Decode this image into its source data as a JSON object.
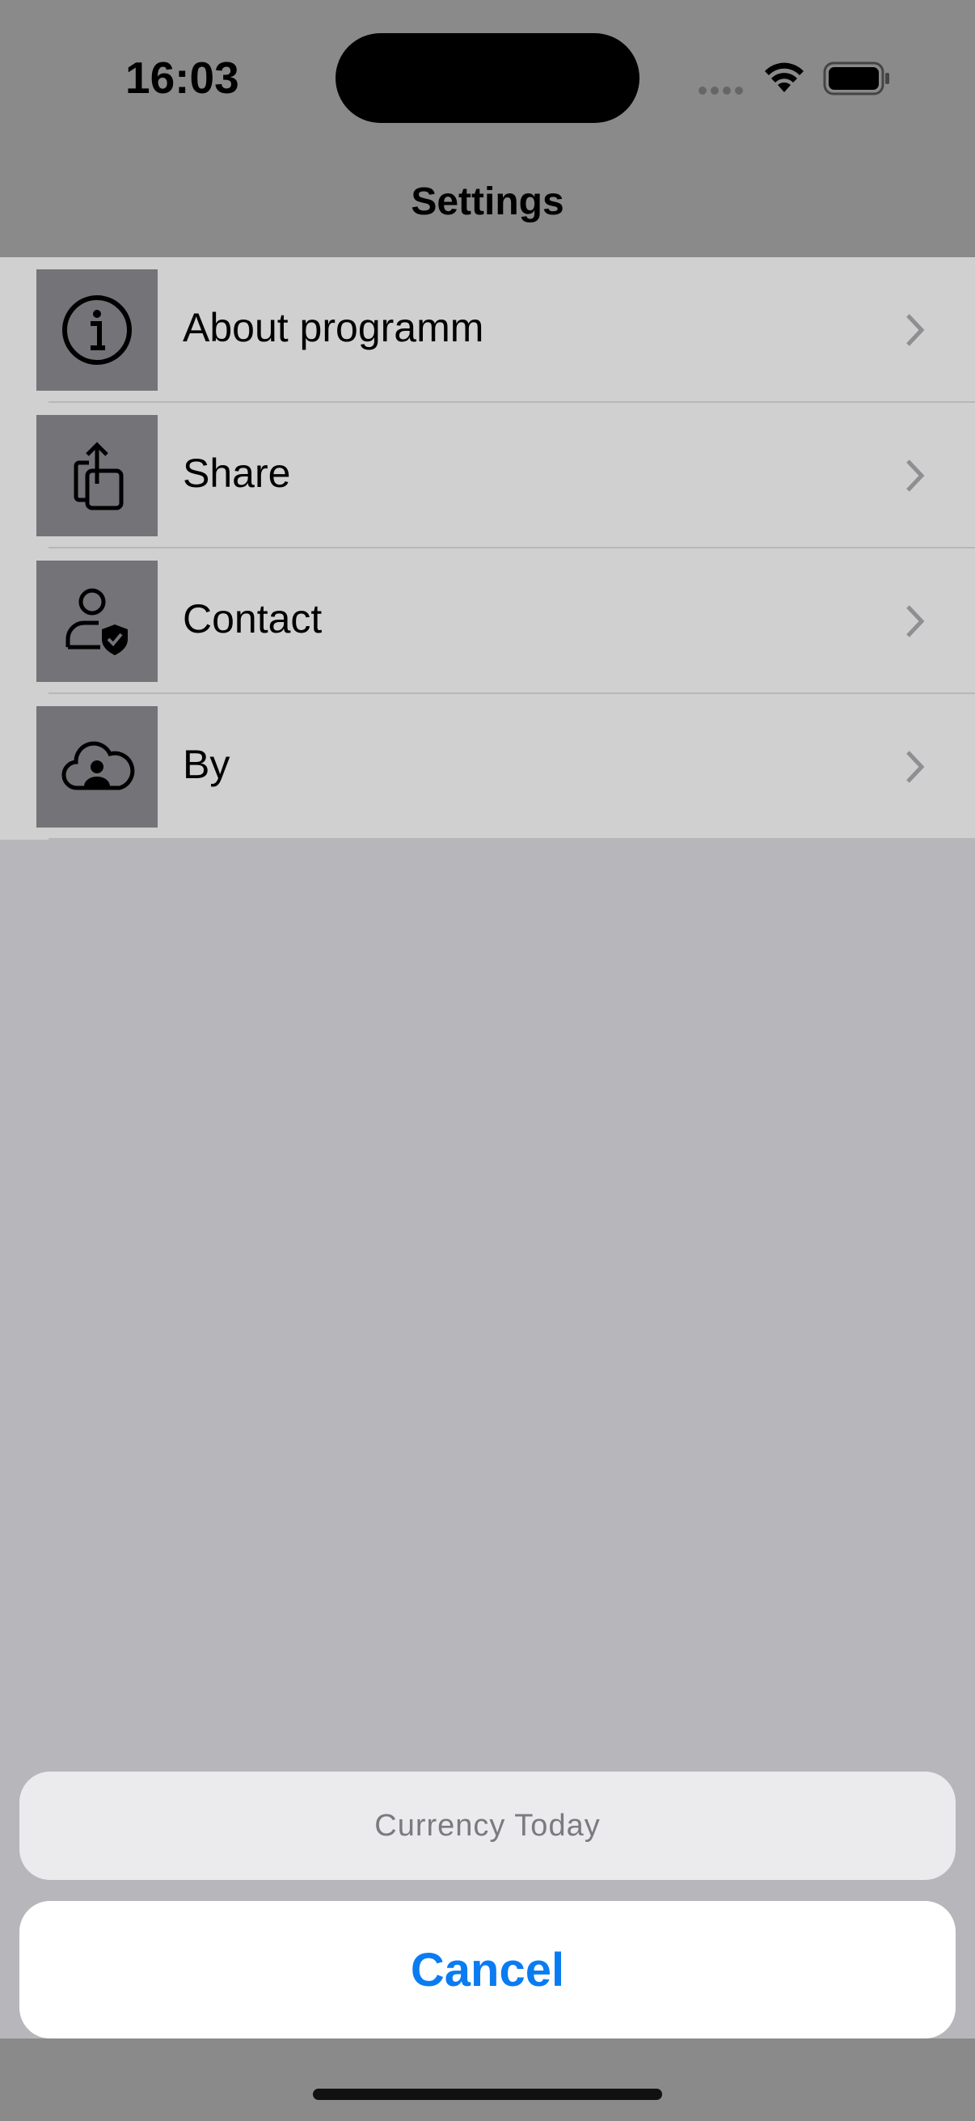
{
  "status_bar": {
    "time": "16:03"
  },
  "nav": {
    "title": "Settings"
  },
  "menu_items": [
    {
      "label": "About programm",
      "icon": "info-icon"
    },
    {
      "label": "Share",
      "icon": "share-icon"
    },
    {
      "label": "Contact",
      "icon": "contact-verified-icon"
    },
    {
      "label": "By",
      "icon": "cloud-person-icon"
    }
  ],
  "action_sheet": {
    "title": "Currency Today",
    "cancel_label": "Cancel"
  },
  "colors": {
    "accent": "#0a7cf2",
    "icon_tile": "#737378"
  }
}
